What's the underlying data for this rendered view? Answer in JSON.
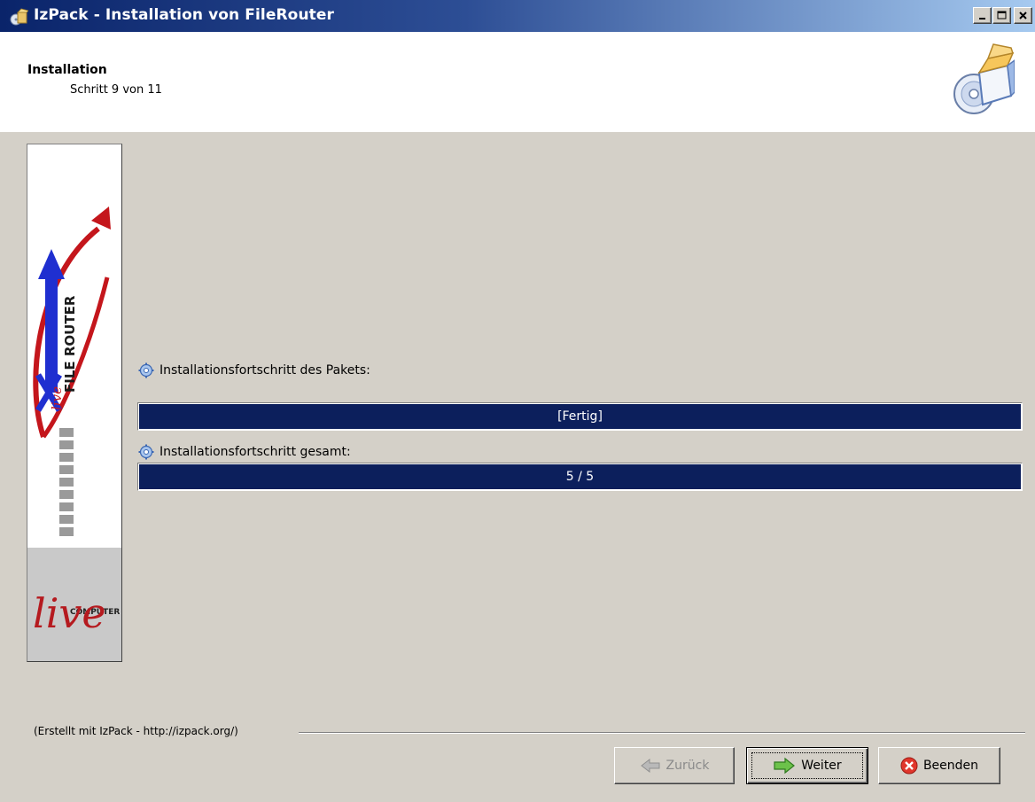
{
  "window": {
    "title": "IzPack - Installation von FileRouter",
    "controls": [
      "minimize-icon",
      "maximize-icon",
      "close-icon"
    ]
  },
  "header": {
    "title": "Installation",
    "step": "Schritt 9 von 11",
    "icon": "package-cd-icon"
  },
  "side_panel": {
    "logo_vertical_text": "FILE ROUTER",
    "logo_brand_small": "live",
    "bottom_logo_top": "COMPUTER",
    "bottom_logo_main": "live"
  },
  "progress": {
    "package_label": "Installationsfortschritt des Pakets:",
    "package_text": "[Fertig]",
    "package_fraction": 1.0,
    "overall_label": "Installationsfortschritt gesamt:",
    "overall_text": "5 / 5",
    "overall_fraction": 1.0
  },
  "footer": {
    "credit": "(Erstellt mit IzPack - http://izpack.org/)"
  },
  "buttons": {
    "back": "Zurück",
    "next": "Weiter",
    "quit": "Beenden"
  },
  "colors": {
    "progress_fill": "#0c1f5c",
    "titlebar_start": "#0a246a",
    "titlebar_end": "#a6caf0",
    "dialog_bg": "#d4d0c8"
  }
}
